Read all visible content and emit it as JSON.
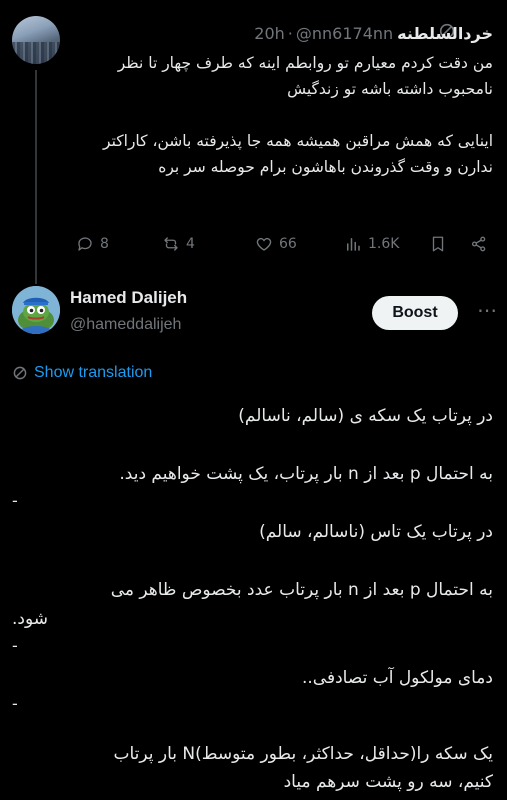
{
  "tweet1": {
    "display_name": "خردالسلطنه",
    "handle": "@nn6174nn",
    "separator": "·",
    "time": "20h",
    "paragraphs": [
      "من دقت کردم معیارم تو روابطم اینه که طرف چهار تا نظر نامحبوب داشته باشه تو زندگیش",
      "اینایی که همش مراقبن همیشه همه جا پذیرفته باشن، کاراکتر ندارن و وقت گذروندن باهاشون برام حوصله سر بره"
    ],
    "actions": {
      "replies": "8",
      "reposts": "4",
      "likes": "66",
      "views": "1.6K"
    }
  },
  "tweet2": {
    "display_name": "Hamed Dalijeh",
    "handle": "@hameddalijeh",
    "boost_label": "Boost",
    "more_label": "⋯",
    "show_translation": "Show translation",
    "lines": {
      "l1": "در پرتاب یک سکه ی (سالم، ناسالم)",
      "l2": "به احتمال p بعد از n بار پرتاب، یک پشت خواهیم دید.",
      "l3": "در پرتاب یک تاس (ناسالم، سالم)",
      "l4": "به احتمال p بعد از n بار پرتاب عدد بخصوص ظاهر می",
      "l5": "شود.",
      "l6": "دمای مولکول آب تصادفی..",
      "l7": "یک سکه را(حداقل، حداکثر، بطور متوسط)N بار پرتاب",
      "l8": "کنیم، سه رو پشت سرهم میاد",
      "dash": "-"
    }
  }
}
